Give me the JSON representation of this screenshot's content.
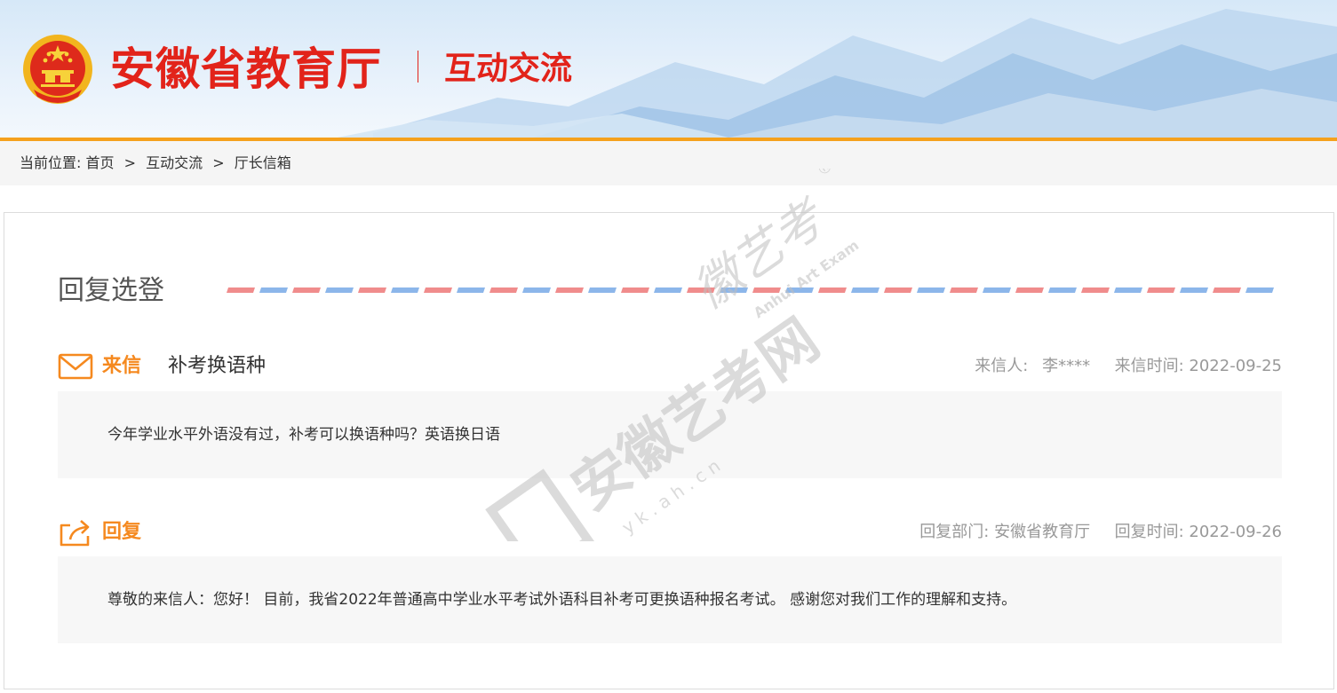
{
  "header": {
    "site_title": "安徽省教育厅",
    "section_title": "互动交流"
  },
  "breadcrumb": {
    "label": "当前位置:",
    "items": [
      "首页",
      "互动交流",
      "厅长信箱"
    ],
    "separator": ">"
  },
  "card": {
    "title": "回复选登",
    "letter": {
      "tag": "来信",
      "subject": "补考换语种",
      "sender_label": "来信人:",
      "sender": "李****",
      "time_label": "来信时间:",
      "time": "2022-09-25",
      "content": "今年学业水平外语没有过，补考可以换语种吗？英语换日语"
    },
    "reply": {
      "tag": "回复",
      "dept_label": "回复部门:",
      "dept": "安徽省教育厅",
      "time_label": "回复时间:",
      "time": "2022-09-26",
      "content": "尊敬的来信人：您好！ 目前，我省2022年普通高中学业水平考试外语科目补考可更换语种报名考试。 感谢您对我们工作的理解和支持。"
    }
  },
  "watermark": {
    "main": "安徽艺考网",
    "script": "徽艺考",
    "url": "y k . a h . c n",
    "en": "Anhui Art Exam",
    "reg": "®"
  },
  "colors": {
    "accent_red": "#e2231a",
    "accent_orange": "#f5a11d",
    "icon_orange": "#f5891f",
    "airmail_red": "#f08c8c",
    "airmail_blue": "#8cb6ea"
  },
  "icons": {
    "emblem": "national-emblem-icon",
    "letter": "envelope-icon",
    "reply": "share-reply-icon"
  }
}
